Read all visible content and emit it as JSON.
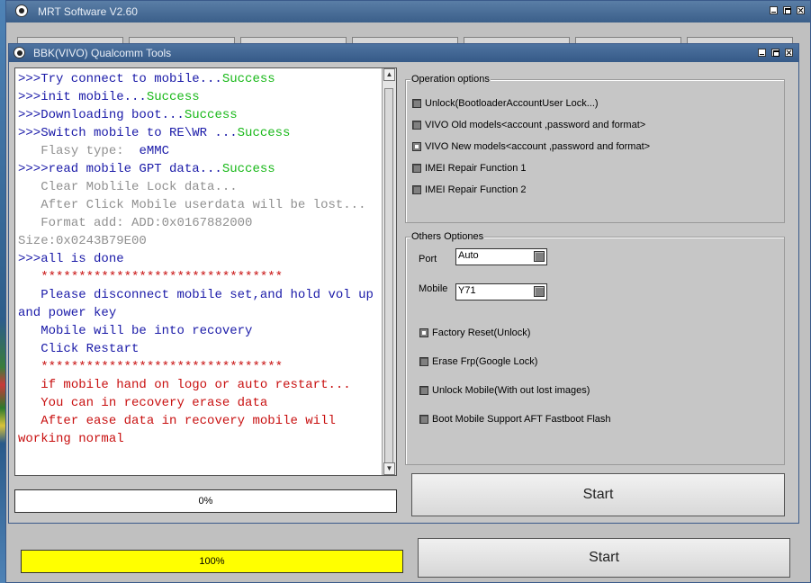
{
  "outer_window": {
    "title": "MRT Software V2.60",
    "progress_text": "100%",
    "start_label": "Start"
  },
  "inner_window": {
    "title": "BBK(VIVO) Qualcomm Tools",
    "progress_text": "0%",
    "start_label": "Start"
  },
  "log": [
    [
      {
        "t": ">>>Try connect to mobile...",
        "c": "blue"
      },
      {
        "t": "Success",
        "c": "green"
      }
    ],
    [
      {
        "t": ">>>init mobile...",
        "c": "blue"
      },
      {
        "t": "Success",
        "c": "green"
      }
    ],
    [
      {
        "t": ">>>Downloading boot...",
        "c": "blue"
      },
      {
        "t": "Success",
        "c": "green"
      }
    ],
    [
      {
        "t": ">>>Switch mobile to RE\\WR ...",
        "c": "blue"
      },
      {
        "t": "Success",
        "c": "green"
      }
    ],
    [
      {
        "t": "   Flasy type:  ",
        "c": "gray"
      },
      {
        "t": "eMMC",
        "c": "blue"
      }
    ],
    [
      {
        "t": ">>>>read mobile GPT data...",
        "c": "blue"
      },
      {
        "t": "Success",
        "c": "green"
      }
    ],
    [
      {
        "t": "   Clear Moblile Lock data...",
        "c": "gray"
      }
    ],
    [
      {
        "t": "   After Click Mobile userdata will be lost...",
        "c": "gray"
      }
    ],
    [
      {
        "t": "   Format add: ADD:0x0167882000",
        "c": "gray"
      }
    ],
    [
      {
        "t": "Size:0x0243B79E00",
        "c": "gray"
      }
    ],
    [
      {
        "t": ">>>all is done",
        "c": "blue"
      }
    ],
    [
      {
        "t": "   ********************************",
        "c": "red"
      }
    ],
    [
      {
        "t": "   Please disconnect mobile set,and hold vol up and power key",
        "c": "blue"
      }
    ],
    [
      {
        "t": "   Mobile will be into recovery",
        "c": "blue"
      }
    ],
    [
      {
        "t": "   Click Restart",
        "c": "blue"
      }
    ],
    [
      {
        "t": "   ********************************",
        "c": "red"
      }
    ],
    [
      {
        "t": "   if mobile hand on logo or auto restart...",
        "c": "red"
      }
    ],
    [
      {
        "t": "   You can in recovery erase data",
        "c": "red"
      }
    ],
    [
      {
        "t": "   After ease data in recovery mobile will working normal",
        "c": "red"
      }
    ]
  ],
  "colors": {
    "blue": "#1a1aa8",
    "green": "#18b818",
    "gray": "#909090",
    "red": "#c81010",
    "progress_fill": "#ffff00"
  },
  "operation_options": {
    "legend": "Operation options",
    "items": [
      "Unlock(BootloaderAccountUser Lock...)",
      "VIVO Old models<account ,password and format>",
      "VIVO New models<account ,password and format>",
      "IMEI Repair Function 1",
      "IMEI Repair Function 2"
    ]
  },
  "others_options": {
    "legend": "Others Optiones",
    "port_label": "Port",
    "port_value": "Auto",
    "mobile_label": "Mobile",
    "mobile_value": "Y71",
    "items": [
      "Factory Reset(Unlock)",
      "Erase Frp(Google Lock)",
      "Unlock Mobile(With out lost images)",
      "Boot Mobile Support AFT Fastboot Flash"
    ]
  },
  "progress": {
    "inner": 0,
    "outer": 100
  }
}
